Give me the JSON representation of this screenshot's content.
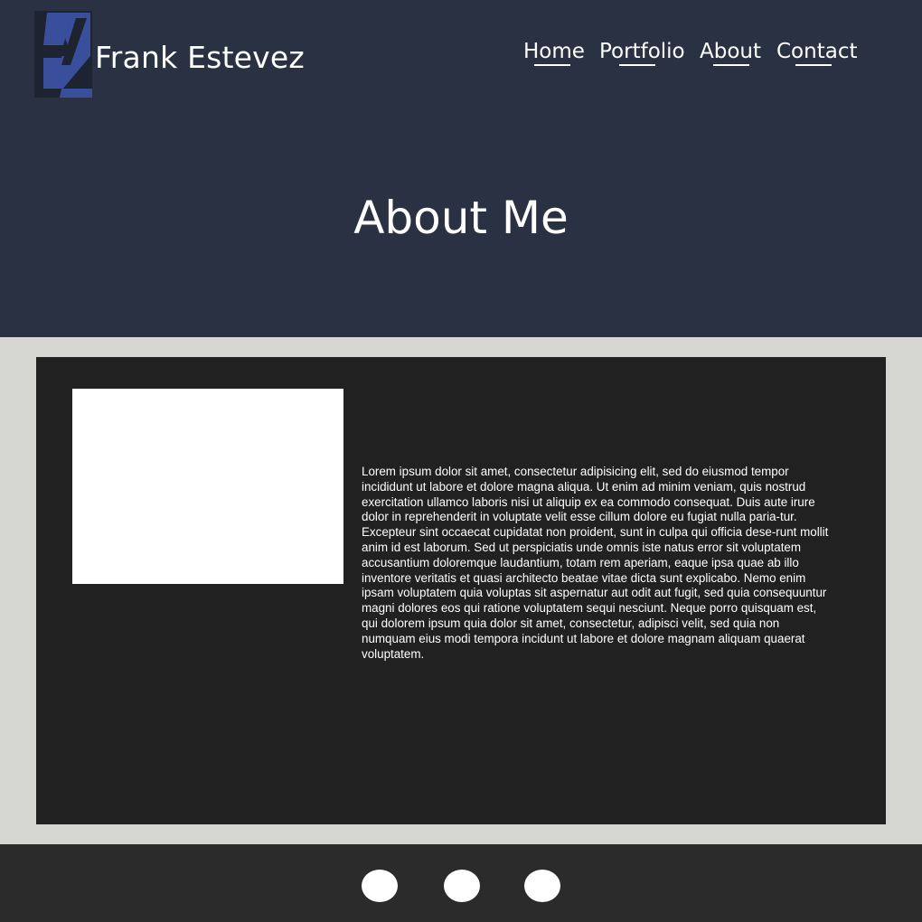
{
  "header": {
    "logo_icon": "fe-monogram-logo",
    "site_name": "Frank Estevez",
    "colors": {
      "background": "#293142",
      "logo_blue": "#3a4f9c",
      "logo_dark": "#1d2331"
    }
  },
  "nav": {
    "items": [
      {
        "label": "Home"
      },
      {
        "label": "Portfolio"
      },
      {
        "label": "About"
      },
      {
        "label": "Contact"
      }
    ]
  },
  "page": {
    "title": "About Me"
  },
  "content": {
    "photo_icon": "profile-photo-placeholder",
    "bio": "Lorem ipsum dolor sit amet, consectetur adipisicing elit, sed do eiusmod tempor incididunt ut labore et dolore magna aliqua. Ut enim ad minim veniam, quis nostrud exercitation ullamco laboris nisi ut aliquip ex ea commodo consequat. Duis aute irure dolor in reprehenderit in voluptate velit esse cillum dolore eu fugiat nulla paria-tur. Excepteur sint occaecat cupidatat non proident, sunt in culpa qui officia dese-runt mollit anim id est laborum. Sed ut perspiciatis unde omnis iste natus error sit voluptatem accusantium doloremque laudantium, totam rem aperiam, eaque ipsa quae ab illo inventore veritatis et quasi architecto beatae vitae dicta sunt explicabo. Nemo enim ipsam voluptatem quia voluptas sit aspernatur aut odit aut fugit, sed quia consequuntur magni dolores eos qui ratione voluptatem sequi nesciunt. Neque porro quisquam est, qui dolorem ipsum quia dolor sit amet, consectetur, adipisci velit, sed quia non numquam eius modi tempora incidunt ut labore et dolore magnam aliquam quaerat voluptatem.",
    "colors": {
      "page_background": "#d5d6d1",
      "panel_background": "#222122"
    }
  },
  "footer": {
    "social_icons": [
      "social-icon-1",
      "social-icon-2",
      "social-icon-3"
    ],
    "colors": {
      "background": "#2b2b2b"
    }
  }
}
